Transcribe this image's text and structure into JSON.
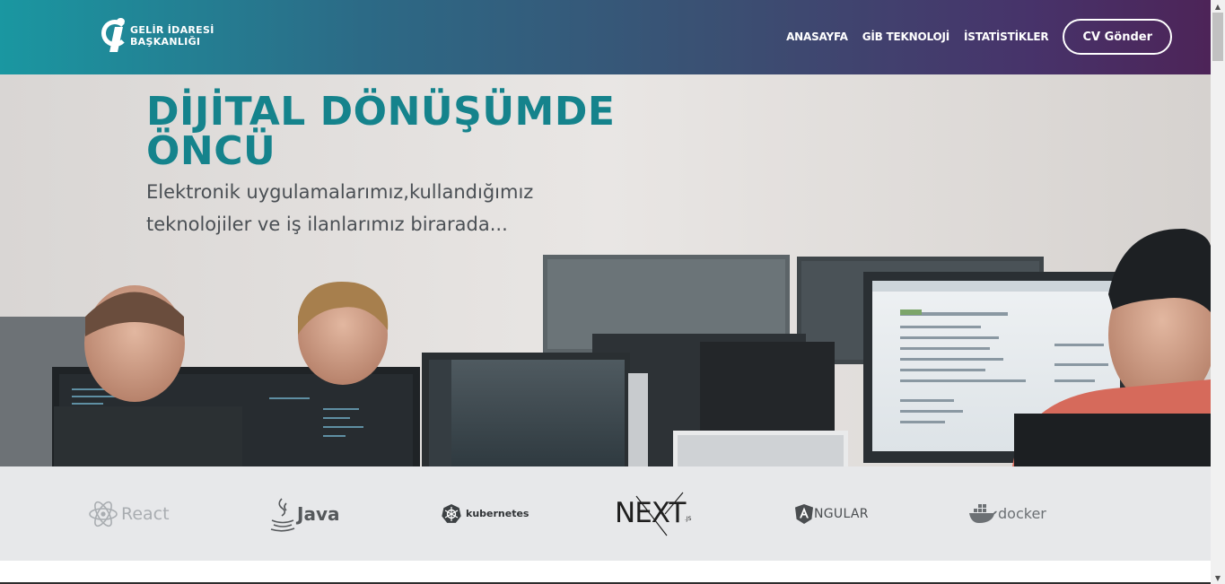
{
  "header": {
    "logo_line1": "GELİR İDARESİ",
    "logo_line2": "BAŞKANLIĞI",
    "nav": [
      {
        "label": "ANASAYFA"
      },
      {
        "label": "GİB TEKNOLOJİ"
      },
      {
        "label": "İSTATİSTİKLER"
      }
    ],
    "cta_label": "CV Gönder"
  },
  "hero": {
    "title_line1": "DİJİTAL DÖNÜŞÜMDE",
    "title_line2": "ÖNCÜ",
    "subtitle_line1": "Elektronik uygulamalarımız,kullandığımız",
    "subtitle_line2": "teknolojiler ve iş ilanlarımız birarada...",
    "title_color": "#15838c"
  },
  "technologies": [
    {
      "name": "React",
      "icon": "react-icon"
    },
    {
      "name": "Java",
      "icon": "java-icon"
    },
    {
      "name": "kubernetes",
      "icon": "kubernetes-icon"
    },
    {
      "name": "NEXT",
      "suffix": ".JS",
      "icon": "nextjs-icon"
    },
    {
      "name": "NGULAR",
      "icon": "angular-icon"
    },
    {
      "name": "docker",
      "icon": "docker-icon"
    }
  ],
  "colors": {
    "header_gradient_start": "#1a97a1",
    "header_gradient_end": "#4d2458",
    "techbar_bg": "#e7e8ea"
  }
}
